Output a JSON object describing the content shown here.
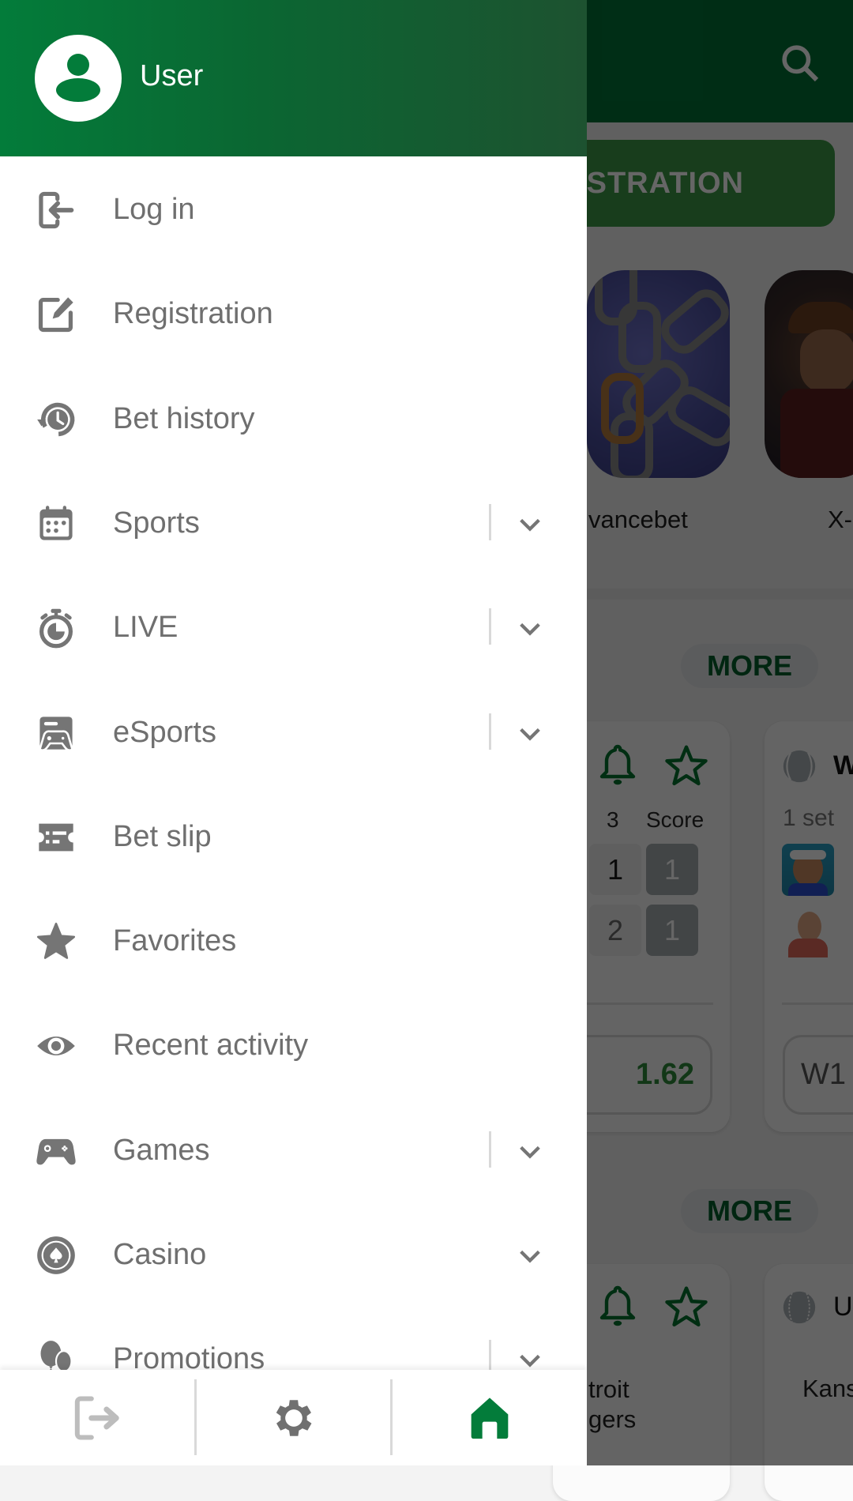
{
  "background": {
    "header": {
      "search_icon": "search-icon"
    },
    "registration_button": {
      "label": "REGISTRATION",
      "visible_label": "ISTRATION"
    },
    "games": [
      {
        "title_visible": "vancebet",
        "image": "chains-slot-thumbnail"
      },
      {
        "title_visible": "X-",
        "image": "cowboy-slot-thumbnail"
      }
    ],
    "sections": [
      {
        "more_label": "MORE",
        "cards": [
          {
            "icons": [
              "bell-icon",
              "star-outline-icon"
            ],
            "columns": [
              "3",
              "Score"
            ],
            "rows": [
              {
                "set3": "1",
                "score": "1"
              },
              {
                "set3": "2",
                "score": "1"
              }
            ],
            "odds": "1.62"
          },
          {
            "sport_icon": "tennis-ball-icon",
            "title_visible": "W",
            "period": "1 set",
            "players": [
              "player-1-avatar",
              "player-2-avatar"
            ],
            "odds_label": "W1"
          }
        ]
      },
      {
        "more_label": "MORE",
        "cards": [
          {
            "icons": [
              "bell-icon",
              "star-outline-icon"
            ],
            "team_lines": [
              "troit",
              "gers"
            ]
          },
          {
            "sport_icon": "baseball-icon",
            "title_visible": "U",
            "team_visible": "Kans"
          }
        ]
      }
    ]
  },
  "drawer": {
    "user": {
      "name": "User",
      "avatar_icon": "user-avatar-icon"
    },
    "items": [
      {
        "label": "Log in",
        "icon": "login-icon",
        "expandable": false,
        "separator": false
      },
      {
        "label": "Registration",
        "icon": "edit-icon",
        "expandable": false,
        "separator": false
      },
      {
        "label": "Bet history",
        "icon": "history-icon",
        "expandable": false,
        "separator": false
      },
      {
        "label": "Sports",
        "icon": "calendar-icon",
        "expandable": true,
        "separator": true
      },
      {
        "label": "LIVE",
        "icon": "stopwatch-icon",
        "expandable": true,
        "separator": true
      },
      {
        "label": "eSports",
        "icon": "esports-icon",
        "expandable": true,
        "separator": true
      },
      {
        "label": "Bet slip",
        "icon": "ticket-icon",
        "expandable": false,
        "separator": false
      },
      {
        "label": "Favorites",
        "icon": "star-icon",
        "expandable": false,
        "separator": false
      },
      {
        "label": "Recent activity",
        "icon": "eye-icon",
        "expandable": false,
        "separator": false
      },
      {
        "label": "Games",
        "icon": "gamepad-icon",
        "expandable": true,
        "separator": true
      },
      {
        "label": "Casino",
        "icon": "casino-chip-icon",
        "expandable": true,
        "separator": false
      },
      {
        "label": "Promotions",
        "icon": "balloons-icon",
        "expandable": true,
        "separator": true
      }
    ],
    "bottom_bar": [
      {
        "name": "logout",
        "icon": "logout-icon",
        "active": false
      },
      {
        "name": "settings",
        "icon": "gear-icon",
        "active": false
      },
      {
        "name": "home",
        "icon": "home-icon",
        "active": true
      }
    ]
  },
  "colors": {
    "brand_green": "#037c3a",
    "menu_text": "#6f6f6f",
    "odds_green": "#2e8b3a",
    "disabled_icon": "#bdbdbd"
  }
}
